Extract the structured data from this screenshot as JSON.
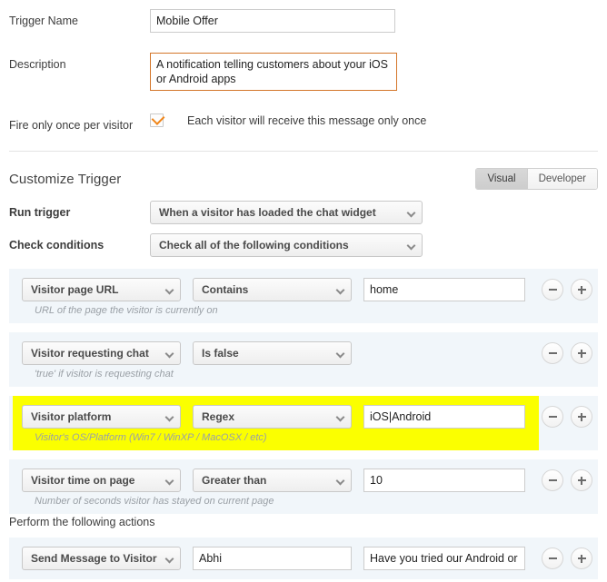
{
  "fields": {
    "trigger_name_label": "Trigger Name",
    "trigger_name_value": "Mobile Offer",
    "description_label": "Description",
    "description_value": "A notification telling customers about your iOS or Android apps",
    "fire_once_label": "Fire only once per visitor",
    "fire_once_text": "Each visitor will receive this message only once",
    "fire_once_checked": true
  },
  "section": {
    "title": "Customize Trigger",
    "mode_tabs": [
      {
        "label": "Visual",
        "active": true
      },
      {
        "label": "Developer",
        "active": false
      }
    ],
    "run_trigger_label": "Run trigger",
    "run_trigger_value": "When a visitor has loaded the chat widget",
    "check_conditions_label": "Check conditions",
    "check_conditions_value": "Check all of the following conditions"
  },
  "conditions": [
    {
      "field": "Visitor page URL",
      "operator": "Contains",
      "value": "home",
      "has_value": true,
      "help": "URL of the page the visitor is currently on",
      "highlighted": false
    },
    {
      "field": "Visitor requesting chat",
      "operator": "Is false",
      "value": "",
      "has_value": false,
      "help": "'true' if visitor is requesting chat",
      "highlighted": false
    },
    {
      "field": "Visitor platform",
      "operator": "Regex",
      "value": "iOS|Android",
      "has_value": true,
      "help": "Visitor's OS/Platform (Win7 / WinXP / MacOSX / etc)",
      "highlighted": true
    },
    {
      "field": "Visitor time on page",
      "operator": "Greater than",
      "value": "10",
      "has_value": true,
      "help": "Number of seconds visitor has stayed on current page",
      "highlighted": false
    }
  ],
  "actions": {
    "title": "Perform the following actions",
    "rows": [
      {
        "type": "Send Message to Visitor",
        "sender": "Abhi",
        "message": "Have you tried our Android or iOS app?"
      }
    ]
  },
  "buttons": {
    "remove_label": "−",
    "add_label": "+"
  },
  "colors": {
    "highlight": "#fbff00",
    "row_background": "#f1f6fa",
    "focus_border": "#d4762a",
    "check_orange": "#f0861a"
  }
}
